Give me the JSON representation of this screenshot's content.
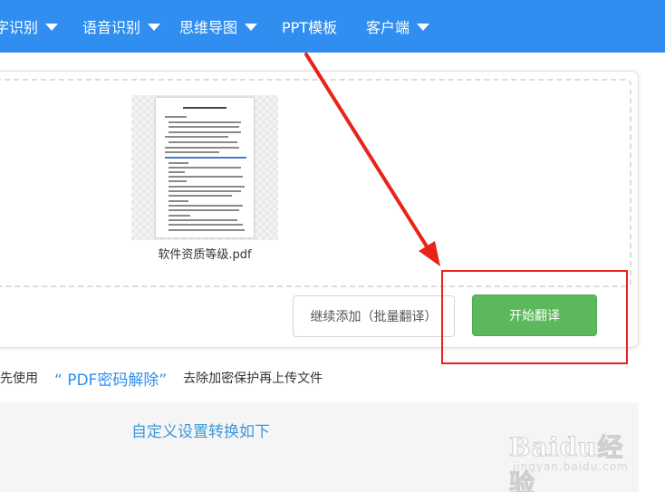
{
  "nav": {
    "items": [
      {
        "label": "字识别"
      },
      {
        "label": "语音识别"
      },
      {
        "label": "思维导图"
      },
      {
        "label": "PPT模板"
      },
      {
        "label": "客户端"
      }
    ]
  },
  "upload": {
    "file_name": "软件资质等级.pdf"
  },
  "buttons": {
    "continue_add": "继续添加（批量翻译）",
    "start_translate": "开始翻译"
  },
  "notice": {
    "prefix": "先使用",
    "link": "“ PDF密码解除”",
    "suffix": "去除加密保护再上传文件"
  },
  "settings": {
    "title": "自定义设置转换如下"
  },
  "watermark": {
    "main": "Baidu经验",
    "sub": "jingyan.baidu.com"
  },
  "colors": {
    "nav_bg": "#2f8ef0",
    "primary_button": "#5cb85c",
    "annotation_red": "#e8231b",
    "link": "#2f8ef0"
  }
}
